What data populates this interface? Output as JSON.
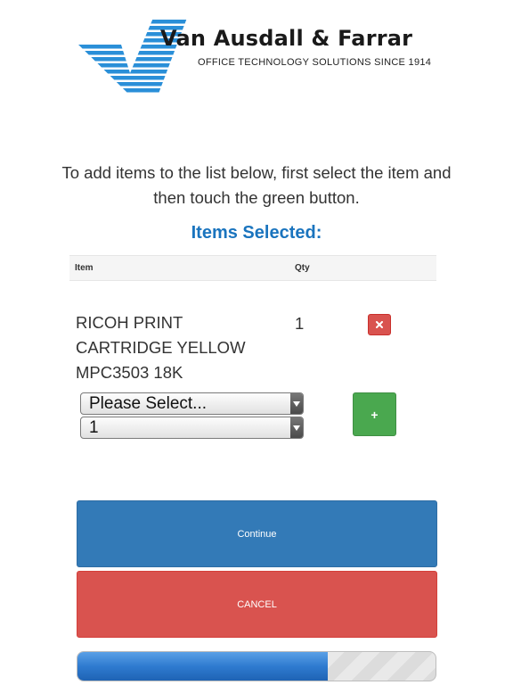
{
  "brand": {
    "name": "Van Ausdall & Farrar",
    "tagline": "OFFICE TECHNOLOGY SOLUTIONS SINCE 1914",
    "logo_icon": "vaf-stripe-logo-icon",
    "logo_color": "#2a8fd8"
  },
  "instructions": "To add items to the list below, first select the item and then touch the green button.",
  "items_title": "Items Selected:",
  "table": {
    "headers": {
      "item": "Item",
      "qty": "Qty"
    },
    "rows": [
      {
        "item": "RICOH PRINT CARTRIDGE YELLOW MPC3503 18K",
        "qty": "1",
        "remove_icon": "close-icon"
      }
    ]
  },
  "form": {
    "item_select": {
      "value": "Please Select..."
    },
    "qty_select": {
      "value": "1"
    },
    "add_label": "+"
  },
  "buttons": {
    "continue": "Continue",
    "cancel": "CANCEL"
  },
  "progress": {
    "value": 0.7
  },
  "colors": {
    "title": "#1a74be",
    "continue": "#337ab7",
    "cancel": "#d9534f",
    "add": "#4aa84f"
  }
}
